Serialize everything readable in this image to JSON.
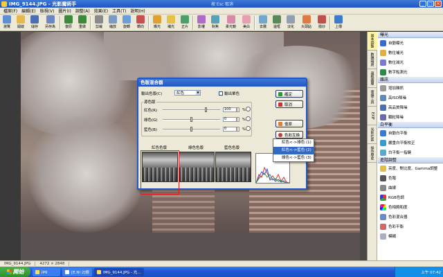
{
  "window": {
    "title": "IMG_9144.JPG - 光影魔術手",
    "center_label": "按 Esc 取消",
    "buttons": [
      "_",
      "□",
      "×"
    ]
  },
  "menu": [
    "檔案(F)",
    "編輯(E)",
    "檢視(V)",
    "圖片(I)",
    "調整(A)",
    "效果(E)",
    "工具(T)",
    "說明(H)"
  ],
  "toolbar": [
    "瀏覽",
    "開啟",
    "儲存",
    "另存為",
    "復原",
    "重做",
    "剪裁",
    "縮放",
    "旋轉",
    "轉向",
    "曝光",
    "補光",
    "正片",
    "影樓",
    "對焦",
    "柔光鏡",
    "美白",
    "去霧",
    "邊框",
    "淡化",
    "大頭貼",
    "撥炒",
    "上傳"
  ],
  "right_panel": {
    "vertical_tabs": [
      "基本調整",
      "數碼暗房",
      "邊框圖層",
      "便捷工具",
      "EXIF",
      "光影社區",
      "操作歷史"
    ],
    "sections": [
      {
        "title": "曝光",
        "items": [
          "自動曝光",
          "數位補光",
          "數位減光",
          "數字點測光"
        ]
      },
      {
        "title": "雜訊",
        "items": [
          "增加雜訊",
          "高ISO降噪",
          "高品質降噪",
          "顆粒降噪"
        ]
      },
      {
        "title": "白平衡",
        "items": [
          "自動白平衡",
          "嚴重白平衡校正",
          "白平衡一指鍵"
        ]
      },
      {
        "title": "進階調整",
        "items": [
          "亮度、對比度、Gamma調整",
          "色階",
          "曲線",
          "RGB色調",
          "色相飽和度",
          "色彩混合器",
          "色彩平衡",
          "模糊"
        ]
      }
    ]
  },
  "status": [
    "IMG_9144.JPG",
    "4272 × 2848"
  ],
  "taskbar": {
    "start": "開始",
    "tasks": [
      "jpg",
      "[E.NI 2]修",
      "IMG_9144.JPG - 光..."
    ],
    "clock": "上午 07:42"
  },
  "dialog": {
    "title": "色版混合器",
    "output_channel_label": "輸出色版(C)",
    "output_channel_value": "紅色",
    "mono_label": "輸出單色",
    "source_group": "源色版",
    "channels": [
      {
        "label": "紅色(R)",
        "value": "100",
        "level": 100
      },
      {
        "label": "綠色(G)",
        "value": "0",
        "level": 0
      },
      {
        "label": "藍色(B)",
        "value": "0",
        "level": 0
      }
    ],
    "pct": "%",
    "buttons": {
      "ok": "確定",
      "cancel": "取消",
      "reset": "復原",
      "swap": "色彩互換"
    },
    "previews": [
      "紅色色版",
      "綠色色版",
      "藍色色版"
    ],
    "swap_options": [
      "紅色<->綠色 (1)",
      "紅色<->藍色 (2)",
      "綠色<->藍色 (3)"
    ],
    "swap_selected_index": 1
  },
  "colors": {
    "titlebar": "#1f55c4",
    "selection": "#316ac5",
    "highlight_box": "#e02020"
  }
}
